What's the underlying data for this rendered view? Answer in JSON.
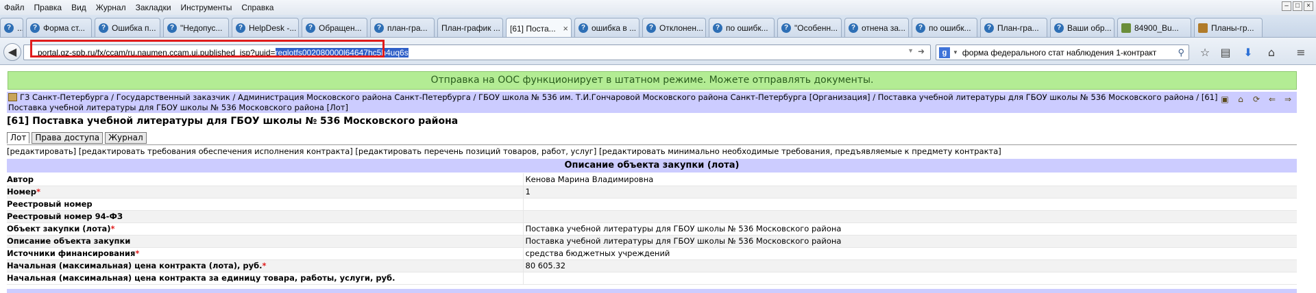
{
  "menu": [
    "Файл",
    "Правка",
    "Вид",
    "Журнал",
    "Закладки",
    "Инструменты",
    "Справка"
  ],
  "tabs": [
    {
      "label": "...",
      "icon": "globe-icon"
    },
    {
      "label": "Форма ст...",
      "icon": "globe-icon"
    },
    {
      "label": "Ошибка п...",
      "icon": "globe-icon"
    },
    {
      "label": "\"Недопус...",
      "icon": "globe-icon"
    },
    {
      "label": "HelpDesk -...",
      "icon": "globe-icon"
    },
    {
      "label": "Обращен...",
      "icon": "globe-icon"
    },
    {
      "label": "план-гра...",
      "icon": "globe-icon"
    },
    {
      "label": "План-график ...",
      "icon": "none"
    },
    {
      "label": "[61] Поста...",
      "icon": "none",
      "active": true,
      "close": "×"
    },
    {
      "label": "ошибка в ...",
      "icon": "globe-icon"
    },
    {
      "label": "Отклонен...",
      "icon": "globe-icon"
    },
    {
      "label": "по ошибк...",
      "icon": "globe-icon"
    },
    {
      "label": "\"Особенн...",
      "icon": "globe-icon"
    },
    {
      "label": "отнена за...",
      "icon": "globe-icon"
    },
    {
      "label": "по ошибк...",
      "icon": "globe-icon"
    },
    {
      "label": "План-гра...",
      "icon": "globe-icon"
    },
    {
      "label": "Ваши обр...",
      "icon": "globe-icon"
    },
    {
      "label": "84900_Bu...",
      "icon": "image-icon"
    },
    {
      "label": "Планы-гр...",
      "icon": "crest-icon"
    }
  ],
  "nav": {
    "url_prefix": "portal.gz-spb.ru/fx/ccam/ru.naumen.ccam.ui.published_jsp?uuid=",
    "url_selected": "reglotfs002080000l64647hc5h4uq6s",
    "search_value": "форма федерального стат наблюдения 1-контракт",
    "search_engine": "g"
  },
  "notice": "Отправка на ООС функционирует в штатном режиме. Можете отправлять документы.",
  "breadcrumb": "ГЗ Санкт-Петербурга / Государственный заказчик / Администрация Московского района Санкт-Петербурга / ГБОУ школа № 536 им. Т.И.Гончаровой Московского района Санкт-Петербурга [Организация] / Поставка учебной литературы для ГБОУ школы № 536 Московского района / [61] Поставка учебной литературы для ГБОУ школы № 536 Московского района [Лот]",
  "page_title": "[61] Поставка учебной литературы для ГБОУ школы № 536 Московского района",
  "subtabs": [
    "Лот",
    "Права доступа",
    "Журнал"
  ],
  "actions": "[редактировать] [редактировать требования обеспечения исполнения контракта] [редактировать перечень позиций товаров, работ, услуг] [редактировать минимально необходимые требования, предъявляемые к предмету контракта]",
  "section_title": "Описание объекта закупки (лота)",
  "properties": [
    {
      "label": "Автор",
      "required": false,
      "value": "Кенова Марина Владимировна"
    },
    {
      "label": "Номер",
      "required": true,
      "value": "1"
    },
    {
      "label": "Реестровый номер",
      "required": false,
      "value": ""
    },
    {
      "label": "Реестровый номер 94-ФЗ",
      "required": false,
      "value": ""
    },
    {
      "label": "Объект закупки (лота)",
      "required": true,
      "value": "Поставка учебной литературы для ГБОУ школы № 536 Московского района"
    },
    {
      "label": "Описание объекта закупки",
      "required": false,
      "value": "Поставка учебной литературы для ГБОУ школы № 536 Московского района"
    },
    {
      "label": "Источники финансирования",
      "required": true,
      "value": "средства бюджетных учреждений"
    },
    {
      "label": "Начальная (максимальная) цена контракта (лота), руб.",
      "required": true,
      "value": "80 605.32"
    },
    {
      "label": "Начальная (максимальная) цена контракта за единицу товара, работы, услуги, руб.",
      "required": false,
      "value": ""
    }
  ],
  "required_mark": "*",
  "colors": {
    "notice_bg": "#b3ec94",
    "header_bg": "#ccccff",
    "highlight_border": "#e01b1b",
    "selection": "#3060c8"
  }
}
